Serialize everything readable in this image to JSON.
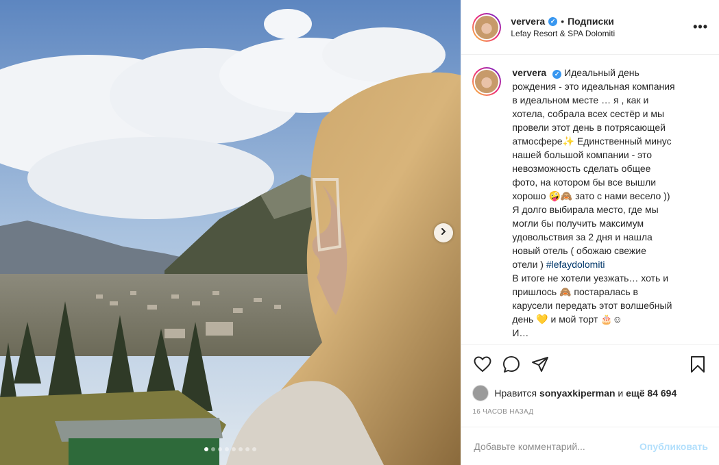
{
  "post": {
    "username": "ververa",
    "verified_mark": "✓",
    "bullet": "•",
    "follow_label": "Подписки",
    "location": "Lefay Resort & SPA Dolomiti",
    "more_icon": "•••"
  },
  "caption": {
    "username": "ververa",
    "lines": [
      "Идеальный день",
      "рождения - это идеальная компания",
      "в идеальном месте … я , как и",
      "хотела, собрала всех сестёр и мы",
      "провели этот день в потрясающей",
      "атмосфере✨ Единственный минус",
      "нашей большой компании - это",
      "невозможность сделать общее",
      "фото, на котором бы все вышли",
      "хорошо 🤪🙈 зато с нами весело ))",
      "Я долго выбирала место, где мы",
      "могли бы получить максимум",
      "удовольствия за 2 дня и нашла",
      "новый отель ( обожаю свежие",
      "отели ) "
    ],
    "hashtag": "#lefaydolomiti",
    "lines2": [
      "В итоге не хотели уезжать… хоть и",
      "пришлось 🙈 постаралась в",
      "карусели передать этот волшебный",
      "день 💛 и мой торт 🎂☺",
      "И…"
    ]
  },
  "actions": {
    "like_icon": "heart-outline",
    "comment_icon": "speech-bubble",
    "share_icon": "paper-plane",
    "save_icon": "bookmark"
  },
  "likes": {
    "prefix": "Нравится",
    "user": "sonyaxkiperman",
    "conj": "и",
    "others": "ещё 84 694"
  },
  "timestamp": "16 ЧАСОВ НАЗАД",
  "comment": {
    "placeholder": "Добавьте комментарий...",
    "publish_label": "Опубликовать"
  },
  "carousel": {
    "total_dots": 8,
    "active_index": 1,
    "next_icon": "chevron-right"
  },
  "colors": {
    "accent": "#3897f0",
    "publish_disabled": "#b2dffc",
    "hashtag": "#00376b"
  }
}
